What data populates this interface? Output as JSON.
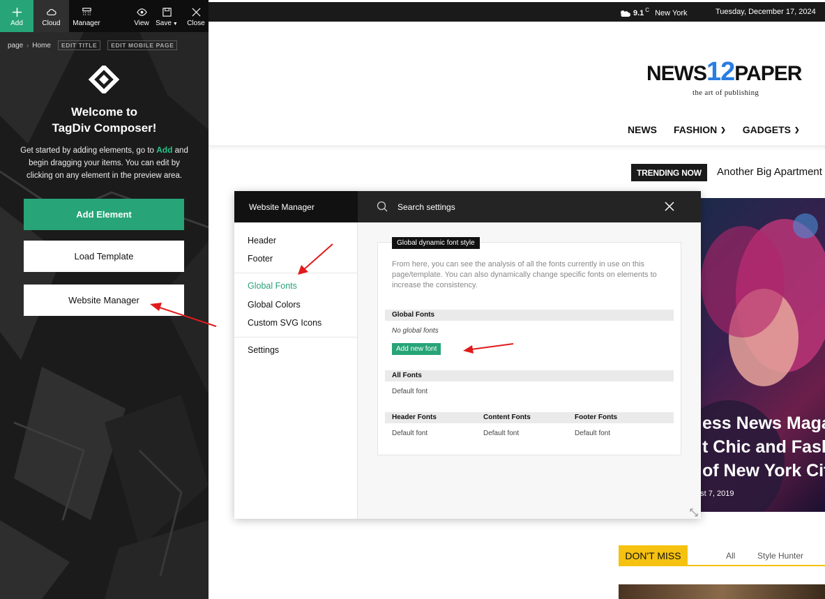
{
  "composer": {
    "toolbar": {
      "add": "Add",
      "cloud": "Cloud",
      "manager": "Manager",
      "view": "View",
      "save": "Save",
      "close": "Close"
    },
    "breadcrumb": {
      "root": "page",
      "current": "Home",
      "edit_title": "EDIT TITLE",
      "edit_mobile": "EDIT MOBILE PAGE"
    },
    "welcome_line1": "Welcome to",
    "welcome_line2": "TagDiv Composer!",
    "intro_before": "Get started by adding elements, go to ",
    "intro_accent": "Add",
    "intro_after": " and begin dragging your items. You can edit by clicking on any element in the preview area.",
    "buttons": {
      "add_element": "Add Element",
      "load_template": "Load Template",
      "website_manager": "Website Manager"
    }
  },
  "site": {
    "weather": {
      "temp": "9.1",
      "unit": "C",
      "city": "New York"
    },
    "date": "Tuesday, December 17, 2024",
    "brand": {
      "part1": "NEWS",
      "num": "12",
      "part2": "PAPER",
      "tagline": "the art of publishing"
    },
    "nav": [
      {
        "label": "NEWS",
        "dropdown": false
      },
      {
        "label": "FASHION",
        "dropdown": true
      },
      {
        "label": "GADGETS",
        "dropdown": true
      }
    ],
    "trending_label": "TRENDING NOW",
    "trending_text": "Another Big Apartment",
    "hero": {
      "line1": "ess News Maga",
      "line2": "t Chic and Fash",
      "line3": "of New York Cit",
      "date": "ust 7, 2019"
    },
    "dont_miss": "DON'T MISS",
    "tabs": [
      "All",
      "Style Hunter"
    ]
  },
  "modal": {
    "title": "Website Manager",
    "search_placeholder": "Search settings",
    "menu": {
      "header": "Header",
      "footer": "Footer",
      "global_fonts": "Global Fonts",
      "global_colors": "Global Colors",
      "custom_svg": "Custom SVG Icons",
      "settings": "Settings"
    },
    "card": {
      "tag": "Global dynamic font style",
      "description": "From here, you can see the analysis of all the fonts currently in use on this page/template. You can also dynamically change specific fonts on elements to increase the consistency.",
      "global_fonts_head": "Global Fonts",
      "global_fonts_empty": "No global fonts",
      "add_font": "Add new font",
      "all_fonts_head": "All Fonts",
      "all_fonts_value": "Default font",
      "header_fonts_head": "Header Fonts",
      "content_fonts_head": "Content Fonts",
      "footer_fonts_head": "Footer Fonts",
      "header_fonts_value": "Default font",
      "content_fonts_value": "Default font",
      "footer_fonts_value": "Default font"
    }
  },
  "colors": {
    "accent_green": "#27a478",
    "dont_miss_yellow": "#f5c211",
    "brand_blue": "#2a7de1",
    "annotation_red": "#e01b1b"
  }
}
